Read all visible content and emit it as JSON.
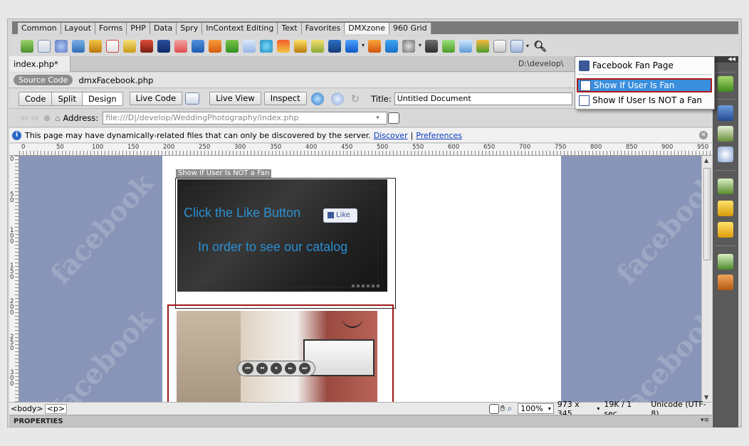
{
  "insert_panel": {
    "tabs": [
      "Common",
      "Layout",
      "Forms",
      "PHP",
      "Data",
      "Spry",
      "InContext Editing",
      "Text",
      "Favorites",
      "DMXzone",
      "960 Grid"
    ],
    "active_tab": "DMXzone"
  },
  "document": {
    "tab_label": "index.php*",
    "close_glyph": "×",
    "path_label": "D:\\develop\\",
    "source_code_label": "Source Code",
    "related_file": "dmxFacebook.php"
  },
  "doc_toolbar": {
    "code_label": "Code",
    "split_label": "Split",
    "design_label": "Design",
    "live_code_label": "Live Code",
    "live_view_label": "Live View",
    "inspect_label": "Inspect",
    "title_label": "Title:",
    "title_value": "Untitled Document"
  },
  "address_bar": {
    "label": "Address:",
    "value": "file:///D|/develop/WeddingPhotography/index.php"
  },
  "info_bar": {
    "message": "This page may have dynamically-related files that can only be discovered by the server.",
    "discover_label": "Discover",
    "separator": "|",
    "preferences_label": "Preferences"
  },
  "ruler": {
    "h_labels": [
      "0",
      "50",
      "100",
      "150",
      "200",
      "250",
      "300",
      "350",
      "400",
      "450",
      "500",
      "550",
      "600",
      "650",
      "700",
      "750",
      "800",
      "850",
      "900",
      "950"
    ],
    "v_labels": [
      "0",
      "5\n0",
      "1\n0\n0",
      "1\n5\n0",
      "2\n0\n0",
      "2\n5\n0",
      "3\n0\n0"
    ]
  },
  "canvas": {
    "watermark": "facebook",
    "region_tag": "Show If User Is NOT a Fan",
    "banner_line1": "Click the Like Button",
    "banner_line2": "In order to see our catalog",
    "like_label": "Like"
  },
  "dropdown_menu": {
    "items": [
      {
        "label": "Facebook Fan Page",
        "selected": false
      },
      {
        "label": "Show If User Is Fan",
        "selected": true
      },
      {
        "label": "Show If User Is NOT a Fan",
        "selected": false
      }
    ]
  },
  "status_bar": {
    "tag_body": "<body>",
    "tag_p": "<p>",
    "zoom": "100%",
    "window_size": "973 x 345",
    "download": "19K / 1 sec",
    "encoding": "Unicode (UTF-8)"
  },
  "properties_label": "PROPERTIES",
  "colors": {
    "accent_blue": "#3a8fdd",
    "highlight_red": "#b11818",
    "canvas_bg": "#8895b8",
    "banner_text": "#2a8fd1"
  }
}
